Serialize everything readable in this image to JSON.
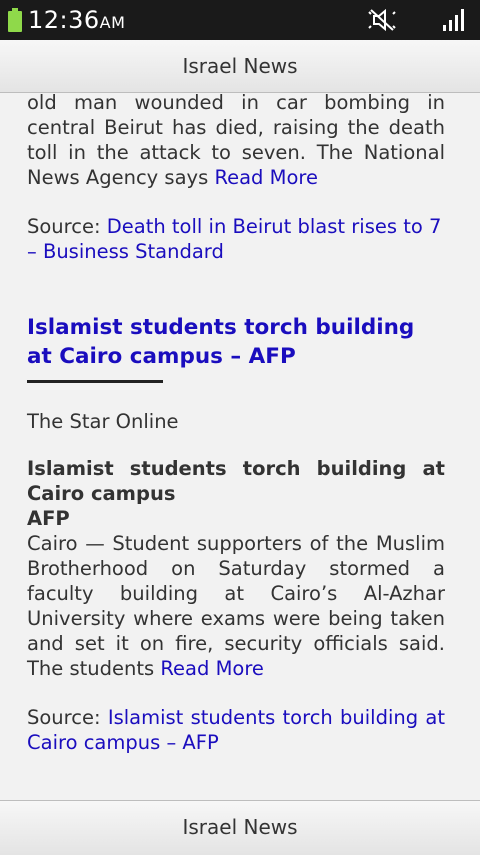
{
  "status_bar": {
    "time": "12:36",
    "ampm": "AM",
    "icons": [
      "battery-icon",
      "mute-icon",
      "signal-icon"
    ],
    "battery_color": "#8fd94a"
  },
  "app": {
    "title": "Israel News",
    "bottom_title": "Israel News"
  },
  "article1": {
    "body_text": "old man wounded in car bombing in central Beirut has died, raising the death toll in the attack to seven. The National News Agency says",
    "read_more": "Read More",
    "source_label": "Source:",
    "source_link": "Death toll in Beirut blast rises to 7 – Business Standard"
  },
  "article2": {
    "title": "Islamist students torch building at Cairo campus – AFP",
    "publisher": "The Star Online",
    "headline": "Islamist students torch building at Cairo campus",
    "agency": "AFP",
    "body_text": "Cairo — Student supporters of the Muslim Brotherhood on Saturday stormed a faculty building at Cairo’s Al-Azhar University where exams were being taken and set it on fire, security officials said. The students",
    "read_more": "Read More",
    "source_label": "Source:",
    "source_link": "Islamist students torch building at Cairo campus – AFP"
  },
  "colors": {
    "link": "#1a0dbe",
    "text": "#333333",
    "status_bar": "#1a1a1a",
    "background": "#f2f2f2"
  }
}
